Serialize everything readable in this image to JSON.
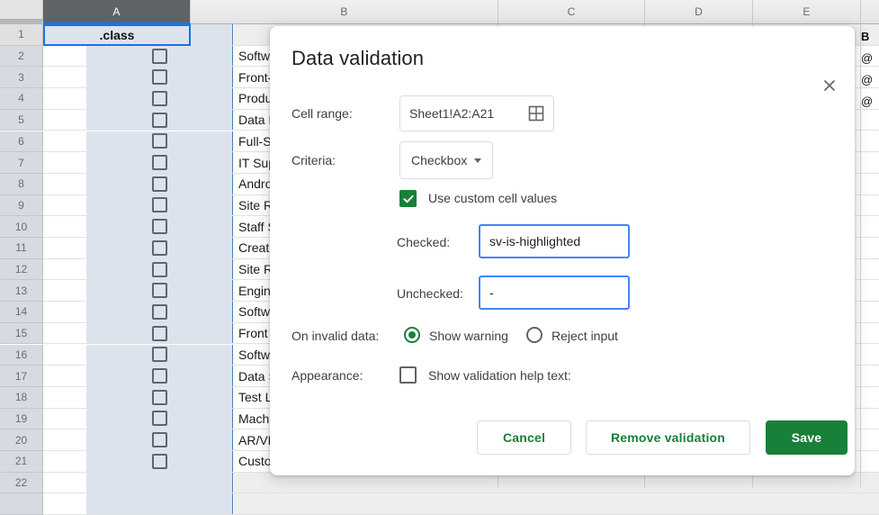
{
  "spreadsheet": {
    "column_headers": [
      "A",
      "B",
      "C",
      "D",
      "E"
    ],
    "selected_column": "A",
    "row_numbers": [
      "1",
      "2",
      "3",
      "4",
      "5",
      "6",
      "7",
      "8",
      "9",
      "10",
      "11",
      "12",
      "13",
      "14",
      "15",
      "16",
      "17",
      "18",
      "19",
      "20",
      "21",
      "22"
    ],
    "a1_value": ".class",
    "column_b_values": [
      "Software Dev",
      "Front-End De",
      "Product Man",
      "Data Enginee",
      "Full-Stack De",
      "IT Support Sp",
      "Android Softw",
      "Site Reliabilit",
      "Staff Softwar",
      "Creative Cod",
      "Site Reliabilit",
      "Engineering",
      "Software Eng",
      "Front End Sc",
      "Software Eng",
      "Data Scientis",
      "Test Lead @",
      "Machine Lea",
      "AR/VR Engin",
      "Customer Ex"
    ],
    "right_sliver_header": "B",
    "right_sliver_cells": [
      "@",
      "@",
      "@"
    ],
    "checkbox_icon": "unchecked-checkbox-icon",
    "selection_color": "#1a73e8",
    "range_fill_color": "#dde3ec"
  },
  "dialog": {
    "title": "Data validation",
    "close_icon": "close-icon",
    "cell_range": {
      "label": "Cell range:",
      "value": "Sheet1!A2:A21",
      "picker_icon": "grid-picker-icon"
    },
    "criteria": {
      "label": "Criteria:",
      "value": "Checkbox",
      "caret_icon": "chevron-down-icon"
    },
    "custom_values": {
      "checkbox_label": "Use custom cell values",
      "checked": true,
      "check_icon": "checkmark-icon",
      "checked_label": "Checked:",
      "checked_value": "sv-is-highlighted",
      "unchecked_label": "Unchecked:",
      "unchecked_value": "-"
    },
    "invalid_data": {
      "label": "On invalid data:",
      "options": [
        "Show warning",
        "Reject input"
      ],
      "selected": "Show warning"
    },
    "appearance": {
      "label": "Appearance:",
      "help_text_label": "Show validation help text:",
      "checked": false
    },
    "buttons": {
      "cancel": "Cancel",
      "remove": "Remove validation",
      "save": "Save"
    },
    "accent_color": "#188038",
    "focus_color": "#4285f4"
  }
}
